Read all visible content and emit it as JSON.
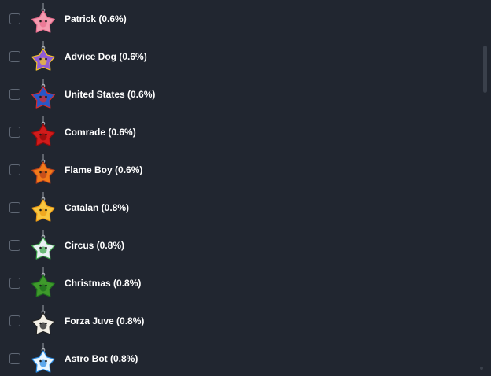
{
  "items": [
    {
      "label": "Patrick (0.6%)",
      "icon": "patrick-star-icon",
      "color": "#f59bb0",
      "accent": "#e86f8f",
      "checked": false
    },
    {
      "label": "Advice Dog (0.6%)",
      "icon": "advice-dog-icon",
      "color": "#8f5bd6",
      "accent": "#f7c429",
      "checked": false
    },
    {
      "label": "United States (0.6%)",
      "icon": "us-flag-star-icon",
      "color": "#2857c8",
      "accent": "#d92b2b",
      "checked": false
    },
    {
      "label": "Comrade (0.6%)",
      "icon": "comrade-star-icon",
      "color": "#d11b1b",
      "accent": "#8f0b0b",
      "checked": false
    },
    {
      "label": "Flame Boy (0.6%)",
      "icon": "flame-boy-icon",
      "color": "#f27a1a",
      "accent": "#b8411b",
      "checked": false
    },
    {
      "label": "Catalan (0.8%)",
      "icon": "catalan-star-icon",
      "color": "#f8c640",
      "accent": "#ee9d16",
      "checked": false
    },
    {
      "label": "Circus (0.8%)",
      "icon": "circus-star-icon",
      "color": "#e8f1f3",
      "accent": "#3fa84d",
      "checked": false
    },
    {
      "label": "Christmas (0.8%)",
      "icon": "christmas-star-icon",
      "color": "#3f9a2b",
      "accent": "#1f6f1f",
      "checked": false
    },
    {
      "label": "Forza Juve (0.8%)",
      "icon": "forza-juve-star-icon",
      "color": "#f4f0e6",
      "accent": "#222222",
      "checked": false
    },
    {
      "label": "Astro Bot (0.8%)",
      "icon": "astro-bot-star-icon",
      "color": "#e9f6ff",
      "accent": "#2d8ee6",
      "checked": false
    }
  ],
  "colors": {
    "background": "#212630",
    "text": "#ffffff",
    "checkbox_border": "#5f6774",
    "scrollbar": "#3a404b"
  }
}
